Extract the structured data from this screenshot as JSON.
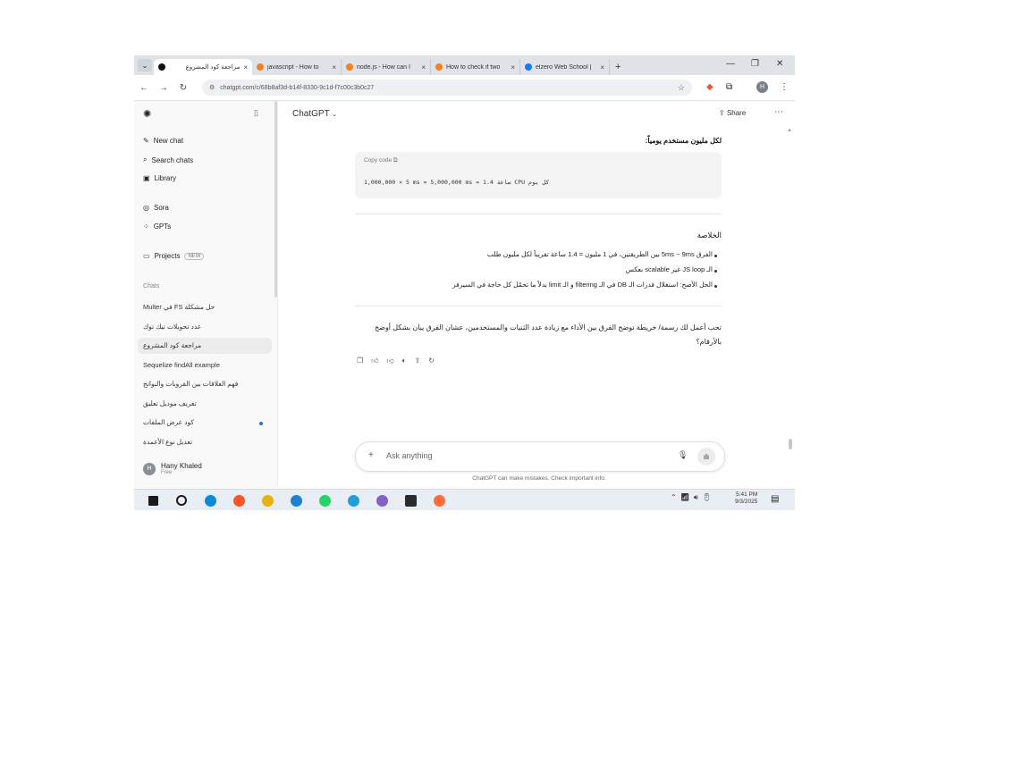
{
  "browser": {
    "tabs": [
      {
        "title": "مراجعة كود المشروع",
        "active": true,
        "icon": "chatgpt-icon",
        "color": "#111111"
      },
      {
        "title": "javascript - How to",
        "active": false,
        "icon": "stackoverflow-icon",
        "color": "#f48024"
      },
      {
        "title": "node.js - How can I",
        "active": false,
        "icon": "stackoverflow-icon",
        "color": "#f48024"
      },
      {
        "title": "How to check if two",
        "active": false,
        "icon": "stackoverflow-icon",
        "color": "#f48024"
      },
      {
        "title": "elzero Web School |",
        "active": false,
        "icon": "facebook-icon",
        "color": "#1877f2"
      }
    ],
    "tab_close": "×",
    "new_tab": "+",
    "url": "chatgpt.com/c/68b8af3d-b14f-8330-9c1d-f7c00c3b0c27"
  },
  "sidebar": {
    "actions": [
      {
        "label": "New chat",
        "icon": "new-chat-icon"
      },
      {
        "label": "Search chats",
        "icon": "search-icon"
      },
      {
        "label": "Library",
        "icon": "library-icon"
      },
      {
        "label": "Sora",
        "icon": "sora-icon"
      },
      {
        "label": "GPTs",
        "icon": "gpts-icon"
      },
      {
        "label": "Projects",
        "icon": "folder-icon"
      }
    ],
    "projects_badge": "NEW",
    "chats_heading": "Chats",
    "chats": [
      {
        "title": "حل مشكلة FS في Multer",
        "active": false
      },
      {
        "title": "عدد تحويلات تيك توك",
        "active": false
      },
      {
        "title": "مراجعة كود المشروع",
        "active": true
      },
      {
        "title": "Sequelize findAll example",
        "active": false
      },
      {
        "title": "فهم العلاقات بين القروبات والنواتج",
        "active": false
      },
      {
        "title": "تعريف موديل تعليق",
        "active": false
      },
      {
        "title": "كود عرض الملفات",
        "active": false,
        "unread": true
      },
      {
        "title": "تعديل نوع الأعمدة",
        "active": false
      }
    ],
    "user": {
      "initials": "H",
      "name": "Hany Khaled",
      "plan": "Free"
    }
  },
  "main": {
    "model_label": "ChatGPT",
    "share_label": "Share",
    "intro_line": "لكل مليون مستخدم يومياً:",
    "code": {
      "header": "Copy code",
      "line": "1,000,000 × 5 ms = 5,000,000 ms = 1.4 ساعة CPU كل يوم"
    },
    "summary_title": "الخلاصة",
    "bullets": [
      "الفرق 5ms ~ 9ms بين الطريقتين، في 1 مليون = 1.4 ساعة تقريباً لكل مليون طلب",
      "الـ JS loop غير scalable بعكس",
      "الحل الأصح: استغلال قدرات الـ DB في الـ filtering و الـ limit بدلاً ما تحمّل كل حاجة في السيرفر"
    ],
    "followup": "تحب أعمل لك رسمة/ خريطة توضح الفرق بين الأداء مع زيادة عدد الثنيات والمستخدمين، عشان الفرق يبان بشكل أوضح بالأرقام؟",
    "composer_placeholder": "Ask anything",
    "disclaimer": "ChatGPT can make mistakes. Check important info."
  },
  "taskbar": {
    "apps": [
      {
        "name": "windows-start-icon",
        "color": "#1a1a1a"
      },
      {
        "name": "search-icon",
        "color": "#1a1a1a"
      },
      {
        "name": "edge-icon",
        "color": "#0c8ad6"
      },
      {
        "name": "brave-icon",
        "color": "#fb542b"
      },
      {
        "name": "chrome-icon",
        "color": "#e9b10b"
      },
      {
        "name": "vscode-icon",
        "color": "#1f7fd1"
      },
      {
        "name": "whatsapp-icon",
        "color": "#25d366"
      },
      {
        "name": "telegram-icon",
        "color": "#229ed9"
      },
      {
        "name": "visual-studio-icon",
        "color": "#8661c5"
      },
      {
        "name": "terminal-icon",
        "color": "#2b2b2b"
      },
      {
        "name": "postman-icon",
        "color": "#ff6c37"
      }
    ],
    "time": "5:41 PM",
    "date": "9/3/2025"
  }
}
